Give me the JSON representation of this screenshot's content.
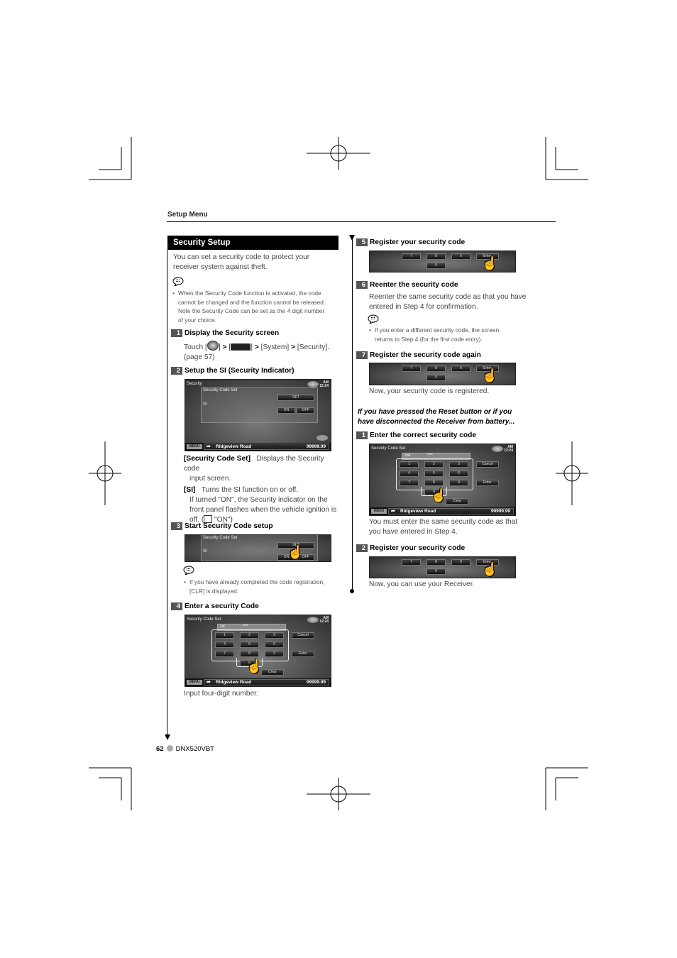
{
  "header": {
    "section": "Setup Menu"
  },
  "left": {
    "title": "Security Setup",
    "intro": "You can set a security code to protect your receiver system against theft.",
    "note1": [
      "When the Security Code function is activated, the code",
      "cannot be changed and the function cannot be released.",
      "Note the Security Code can be set as the 4 digit number",
      "of your choice."
    ],
    "steps": [
      {
        "num": "1",
        "title": "Display the Security screen",
        "text_touch": "Touch [",
        "text_mid1": "] ",
        "text_mid2": " [",
        "text_mid3": "] ",
        "system": " [System] ",
        "security": " [Security].",
        "page": "(page 57)"
      },
      {
        "num": "2",
        "title": "Setup the SI (Security Indicator)",
        "def1_term": "[Security Code Set]",
        "def1_text": "Displays the Security code",
        "def1_text2": "input screen.",
        "def2_term": "[SI]",
        "def2_text": "Turns the SI function on or off.",
        "def2_more": [
          "If turned \"ON\", the Security indicator on the",
          "front panel flashes when the vehicle ignition is"
        ],
        "def2_last": "off. (",
        "def2_default": " \"ON\")"
      },
      {
        "num": "3",
        "title": "Start Security Code setup",
        "note": [
          "If you have already completed the code registration,",
          "[CLR] is displayed."
        ]
      },
      {
        "num": "4",
        "title": "Enter a security Code",
        "caption": "Input four-digit number."
      }
    ]
  },
  "right": {
    "steps": [
      {
        "num": "5",
        "title": "Register your security code"
      },
      {
        "num": "6",
        "title": "Reenter the security code",
        "text": [
          "Reenter the same security code as that you have",
          "entered in Step 4 for confirmation."
        ],
        "note": [
          "If you enter a different security code, the screen",
          "returns to Step 4 (for the first code entry)."
        ]
      },
      {
        "num": "7",
        "title": "Register the security code again",
        "caption": "Now, your security code is registered."
      }
    ],
    "reset_heading": [
      "If you have pressed the Reset button or if you",
      "have disconnected the Receiver from battery..."
    ],
    "reset_steps": [
      {
        "num": "1",
        "title": "Enter the correct security code",
        "caption": [
          "You must enter the same security code as that",
          "you have entered in Step 4."
        ]
      },
      {
        "num": "2",
        "title": "Register your security code",
        "caption": "Now, you can use your Receiver."
      }
    ]
  },
  "screens": {
    "security": {
      "title": "Security",
      "code_set": "Security Code Set",
      "si": "SI",
      "set": "SET",
      "on": "ON",
      "off": "OFF"
    },
    "code_set_title": "Security Code Set",
    "entry_1st": "1st",
    "entry_2nd": "2nd",
    "masked": "****",
    "keys": [
      "1",
      "2",
      "3",
      "4",
      "5",
      "6",
      "7",
      "8",
      "9",
      "0"
    ],
    "cancel": "Cancel",
    "enter": "Enter",
    "clear": "Clear",
    "clock_am": "AM",
    "clock_time": "12:24",
    "menu": "MENU",
    "road": "Ridgeview Road",
    "odometer": "99999.99"
  },
  "footer": {
    "page": "62",
    "model": "DNX520VBT"
  }
}
